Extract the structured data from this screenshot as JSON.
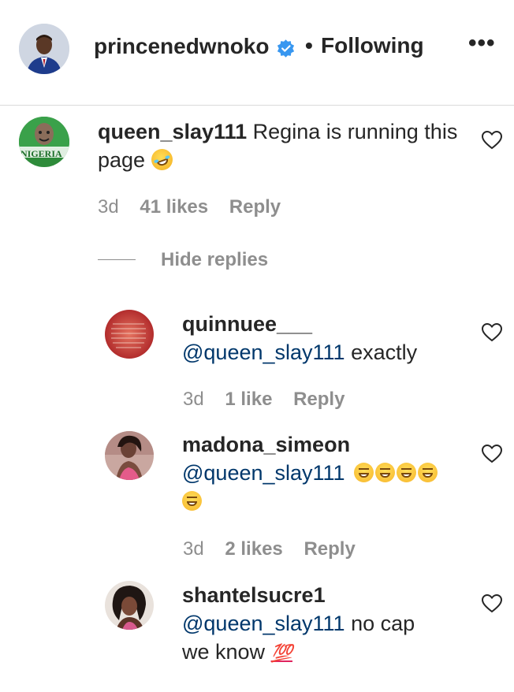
{
  "header": {
    "username": "princenedwnoko",
    "separator": "•",
    "follow_status": "Following",
    "more": "•••"
  },
  "comment": {
    "username": "queen_slay111",
    "text": "Regina is running this page",
    "time": "3d",
    "likes": "41 likes",
    "reply": "Reply",
    "avatar_text": "NIGERIA"
  },
  "hide_replies": "Hide replies",
  "replies": [
    {
      "username": "quinnuee___",
      "mention": "@queen_slay111",
      "text": "exactly",
      "time": "3d",
      "likes": "1 like",
      "reply": "Reply"
    },
    {
      "username": "madona_simeon",
      "mention": "@queen_slay111",
      "text": "",
      "time": "3d",
      "likes": "2 likes",
      "reply": "Reply"
    },
    {
      "username": "shantelsucre1",
      "mention": "@queen_slay111",
      "text": "no cap",
      "text2": "we know",
      "emoji": "💯"
    }
  ],
  "colors": {
    "text": "#262626",
    "muted": "#8e8e8e",
    "mention": "#00376b",
    "verified": "#3897f0"
  }
}
